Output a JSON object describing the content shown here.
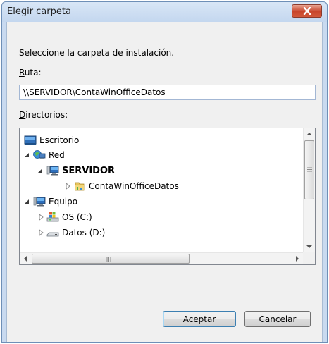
{
  "window": {
    "title": "Elegir carpeta"
  },
  "dialog": {
    "instruction": "Seleccione la carpeta de instalación.",
    "path_label_underlined": "R",
    "path_label_rest": "uta:",
    "path_value": "\\\\SERVIDOR\\ContaWinOfficeDatos",
    "dirs_label_underlined": "D",
    "dirs_label_rest": "irectorios:"
  },
  "tree": {
    "items": [
      {
        "label": "Escritorio",
        "icon": "desktop-icon"
      },
      {
        "label": "Red",
        "icon": "network-icon",
        "expanded": true
      },
      {
        "label": "SERVIDOR",
        "icon": "computer-icon",
        "expanded": true
      },
      {
        "label": "ContaWinOfficeDatos",
        "icon": "shared-folder-icon",
        "expanded": false
      },
      {
        "label": "Equipo",
        "icon": "computer-icon",
        "expanded": true
      },
      {
        "label": "OS (C:)",
        "icon": "windows-drive-icon",
        "expanded": false
      },
      {
        "label": "Datos (D:)",
        "icon": "drive-icon",
        "expanded": false
      }
    ]
  },
  "buttons": {
    "ok": "Aceptar",
    "cancel": "Cancelar"
  },
  "colors": {
    "close": "#c8452b",
    "frame": "#c9daf0",
    "selected_accent": "#3c7fb1"
  }
}
